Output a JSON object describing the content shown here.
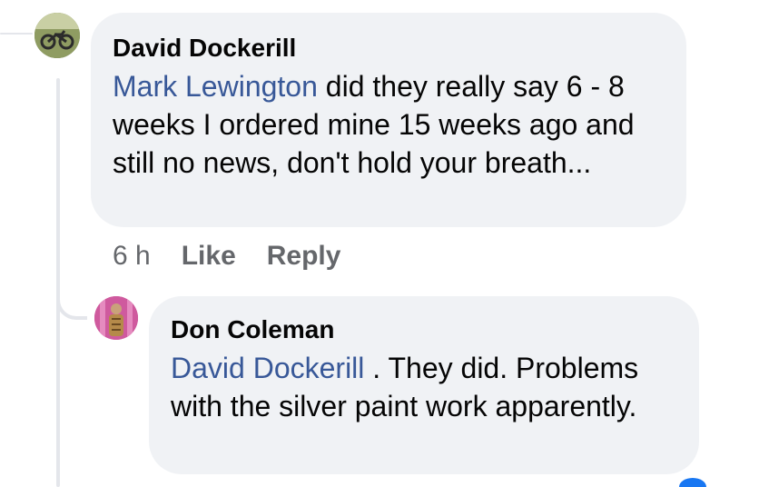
{
  "comments": [
    {
      "author": "David Dockerill",
      "mention": "Mark Lewington",
      "text_line1": " did they really say 6 -",
      "text_rest": "8 weeks I ordered mine 15 weeks ago and still no news, don't hold your breath...",
      "timestamp": "6 h",
      "like_label": "Like",
      "reply_label": "Reply"
    },
    {
      "author": "Don Coleman",
      "mention": "David Dockerill",
      "text": " . They did. Problems with the silver paint work apparently."
    }
  ],
  "icons": {
    "avatar_1": "avatar-photo-motorcycle",
    "avatar_2": "avatar-photo-person"
  },
  "colors": {
    "bubble_bg": "#f0f2f5",
    "mention": "#385898",
    "meta_text": "#65676b",
    "thread_line": "#e4e6eb"
  }
}
